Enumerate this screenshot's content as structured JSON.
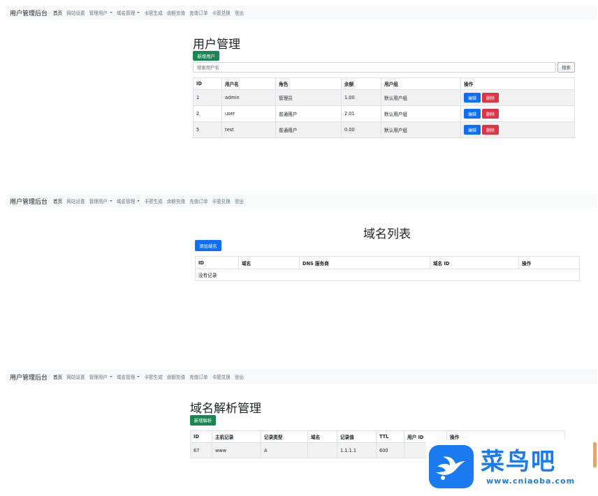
{
  "navbar": {
    "brand": "用户管理后台",
    "items": [
      {
        "label": "首页",
        "active": true,
        "dropdown": false
      },
      {
        "label": "网站设置",
        "active": false,
        "dropdown": false
      },
      {
        "label": "管理用户",
        "active": false,
        "dropdown": true
      },
      {
        "label": "域名管理",
        "active": false,
        "dropdown": true
      },
      {
        "label": "卡密生成",
        "active": false,
        "dropdown": false
      },
      {
        "label": "余额充值",
        "active": false,
        "dropdown": false
      },
      {
        "label": "充值订单",
        "active": false,
        "dropdown": false
      },
      {
        "label": "卡密兑换",
        "active": false,
        "dropdown": false
      },
      {
        "label": "登出",
        "active": false,
        "dropdown": false
      }
    ]
  },
  "users_page": {
    "title": "用户管理",
    "add_button": "新增用户",
    "search_placeholder": "搜索用户名",
    "search_button": "搜索",
    "columns": [
      "ID",
      "用户名",
      "角色",
      "余额",
      "用户组",
      "操作"
    ],
    "rows": [
      {
        "id": "1",
        "username": "admin",
        "role": "管理员",
        "balance": "1.00",
        "group": "默认用户组"
      },
      {
        "id": "2",
        "username": "user",
        "role": "普通用户",
        "balance": "2.01",
        "group": "默认用户组"
      },
      {
        "id": "5",
        "username": "test",
        "role": "普通用户",
        "balance": "0.00",
        "group": "默认用户组"
      }
    ],
    "edit_label": "编辑",
    "delete_label": "删除"
  },
  "domains_page": {
    "title": "域名列表",
    "add_button": "添加域名",
    "columns": [
      "ID",
      "域名",
      "DNS 服务商",
      "域名 ID",
      "操作"
    ],
    "empty_text": "没有记录"
  },
  "dns_page": {
    "title": "域名解析管理",
    "add_button": "新增解析",
    "columns": [
      "ID",
      "主机记录",
      "记录类型",
      "域名",
      "记录值",
      "TTL",
      "用户 ID",
      "操作"
    ],
    "rows": [
      {
        "id": "67",
        "host": "www",
        "type": "A",
        "domain": "",
        "value": "1.1.1.1",
        "ttl": "600",
        "user_id": ""
      }
    ]
  },
  "watermark": {
    "name": "菜鸟吧",
    "url": "www.cniaoba.com",
    "color": "#1a7bf0"
  },
  "colors": {
    "success": "#198754",
    "primary": "#0d6efd",
    "danger": "#dc3545",
    "navbar_bg": "#f8f9fa"
  }
}
